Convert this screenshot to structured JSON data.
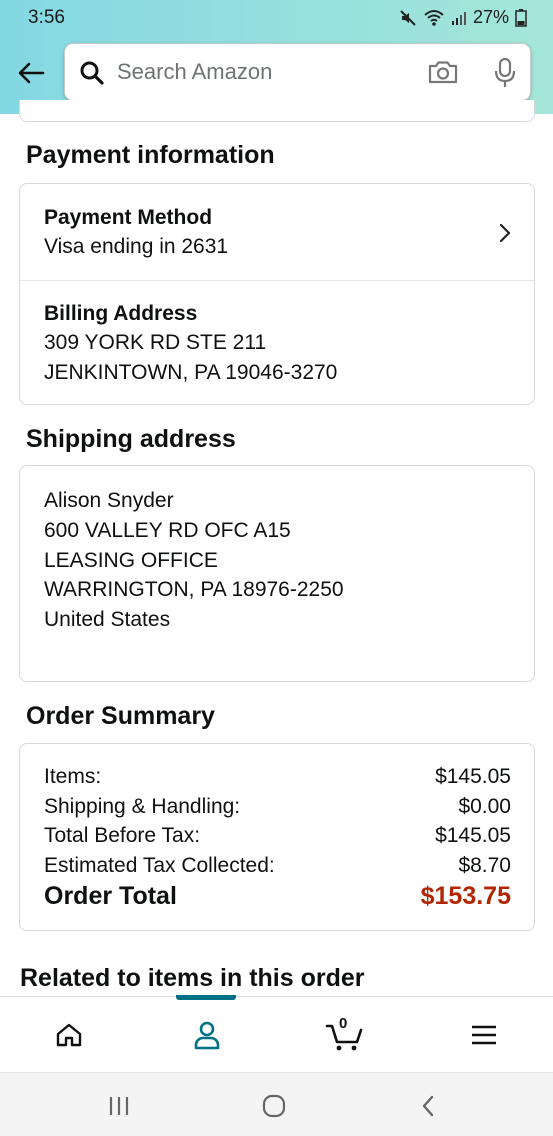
{
  "status_bar": {
    "time": "3:56",
    "battery": "27%"
  },
  "search": {
    "placeholder": "Search Amazon"
  },
  "payment_info": {
    "title": "Payment information",
    "method_label": "Payment Method",
    "method_value": "Visa ending in 2631",
    "billing_label": "Billing Address",
    "billing_line1": "309 YORK RD STE 211",
    "billing_line2": "JENKINTOWN, PA 19046-3270"
  },
  "shipping": {
    "title": "Shipping address",
    "lines": [
      "Alison Snyder",
      "600 VALLEY RD OFC A15",
      "LEASING OFFICE",
      "WARRINGTON, PA 18976-2250",
      "United States"
    ]
  },
  "summary": {
    "title": "Order Summary",
    "rows": [
      {
        "label": "Items:",
        "value": "$145.05"
      },
      {
        "label": "Shipping & Handling:",
        "value": "$0.00"
      },
      {
        "label": "Total Before Tax:",
        "value": "$145.05"
      },
      {
        "label": "Estimated Tax Collected:",
        "value": "$8.70"
      }
    ],
    "total_label": "Order Total",
    "total_value": "$153.75",
    "total_color": "#B12704"
  },
  "related": {
    "title": "Related to items in this order"
  },
  "bottom_nav": {
    "items": [
      "home-icon",
      "account-icon",
      "cart-icon",
      "menu-icon"
    ],
    "active": "account-icon",
    "accent": "#007185",
    "cart_count": "0"
  },
  "system_nav": [
    "recents-icon",
    "home-circle-icon",
    "back-chevron-icon"
  ]
}
